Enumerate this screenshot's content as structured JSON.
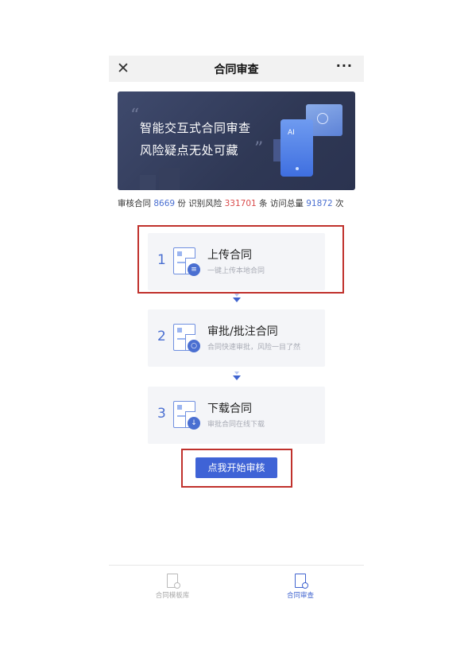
{
  "nav": {
    "close_icon": "close-x-icon",
    "title": "合同审查",
    "more_label": "···"
  },
  "banner": {
    "quote_open": "“",
    "line1": "智能交互式合同审查",
    "line2": "风险疑点无处可藏",
    "quote_close": "”",
    "ai_label": "AI"
  },
  "stats": {
    "reviewed_label": "审核合同",
    "reviewed_value": "8669",
    "reviewed_unit": "份",
    "risk_label": "识别风险",
    "risk_value": "331701",
    "risk_unit": "条",
    "visits_label": "访问总量",
    "visits_value": "91872",
    "visits_unit": "次"
  },
  "steps": [
    {
      "num": "1",
      "title": "上传合同",
      "subtitle": "一键上传本地合同",
      "badge_icon": "document-icon"
    },
    {
      "num": "2",
      "title": "审批/批注合同",
      "subtitle": "合同快速审批，风险一目了然",
      "badge_icon": "search-icon"
    },
    {
      "num": "3",
      "title": "下载合同",
      "subtitle": "审批合同在线下载",
      "badge_icon": "download-icon"
    }
  ],
  "start_button": "点我开始审核",
  "tabs": [
    {
      "label": "合同模板库",
      "icon": "template-search-icon",
      "active": false
    },
    {
      "label": "合同审查",
      "icon": "review-doc-icon",
      "active": true
    }
  ],
  "colors": {
    "accent": "#3f63d6",
    "highlight_box": "#c0312c",
    "risk_red": "#d94a4a",
    "banner_bg": "#2f3855"
  }
}
